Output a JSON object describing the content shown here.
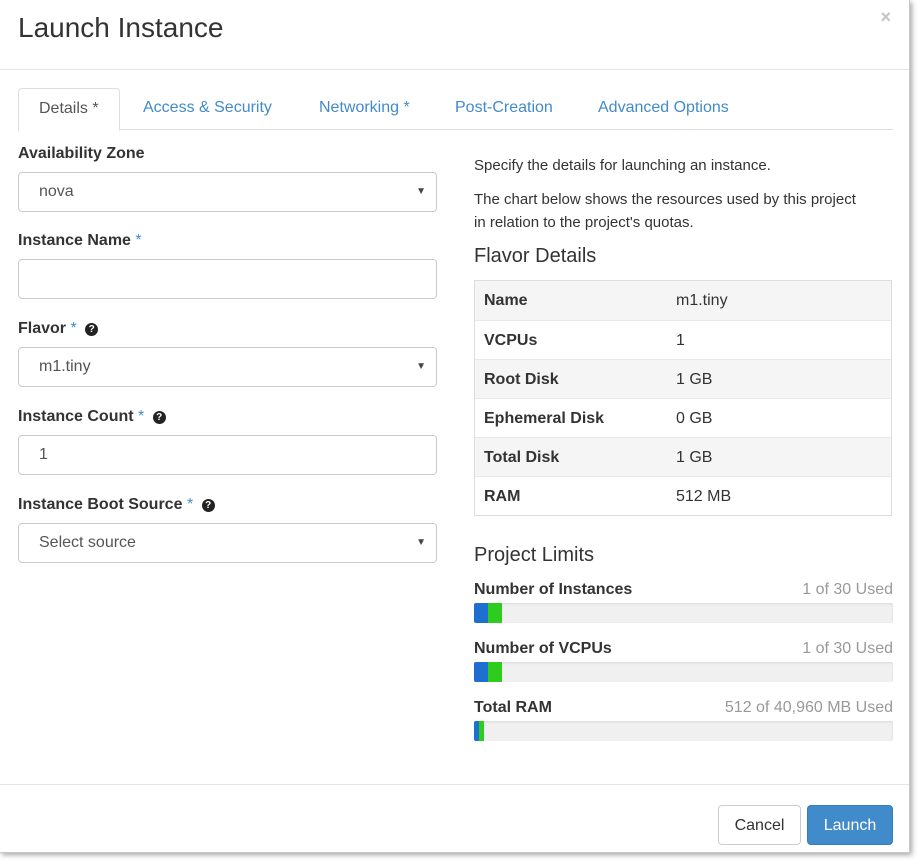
{
  "dialog": {
    "title": "Launch Instance",
    "close_glyph": "×"
  },
  "tabs": [
    {
      "label": "Details",
      "required": "*",
      "active": true
    },
    {
      "label": "Access & Security",
      "required": ""
    },
    {
      "label": "Networking",
      "required": "*"
    },
    {
      "label": "Post-Creation",
      "required": ""
    },
    {
      "label": "Advanced Options",
      "required": ""
    }
  ],
  "form": {
    "availability_zone": {
      "label": "Availability Zone",
      "value": "nova"
    },
    "instance_name": {
      "label": "Instance Name",
      "required": "*",
      "value": ""
    },
    "flavor": {
      "label": "Flavor",
      "required": "*",
      "value": "m1.tiny"
    },
    "instance_count": {
      "label": "Instance Count",
      "required": "*",
      "value": "1"
    },
    "boot_source": {
      "label": "Instance Boot Source",
      "required": "*",
      "value": "Select source"
    }
  },
  "info": {
    "line1": "Specify the details for launching an instance.",
    "line2a": "The chart below shows the resources used by this project",
    "line2b": "in relation to the project's quotas."
  },
  "flavor_details": {
    "title": "Flavor Details",
    "rows": [
      {
        "key": "Name",
        "value": "m1.tiny"
      },
      {
        "key": "VCPUs",
        "value": "1"
      },
      {
        "key": "Root Disk",
        "value": "1 GB"
      },
      {
        "key": "Ephemeral Disk",
        "value": "0 GB"
      },
      {
        "key": "Total Disk",
        "value": "1 GB"
      },
      {
        "key": "RAM",
        "value": "512 MB"
      }
    ]
  },
  "project_limits": {
    "title": "Project Limits",
    "items": [
      {
        "label": "Number of Instances",
        "used_text": "1 of 30 Used",
        "used_fraction": 0.033,
        "added_fraction": 0.033
      },
      {
        "label": "Number of VCPUs",
        "used_text": "1 of 30 Used",
        "used_fraction": 0.033,
        "added_fraction": 0.033
      },
      {
        "label": "Total RAM",
        "used_text": "512 of 40,960 MB Used",
        "used_fraction": 0.0125,
        "added_fraction": 0.0125
      }
    ]
  },
  "footer": {
    "cancel_label": "Cancel",
    "launch_label": "Launch"
  },
  "colors": {
    "accent": "#428bca",
    "bar_used": "#1f6fd0",
    "bar_added": "#2ecc1e"
  },
  "icons": {
    "help": "question-circle-icon",
    "caret": "caret-down-icon",
    "close": "close-icon"
  }
}
